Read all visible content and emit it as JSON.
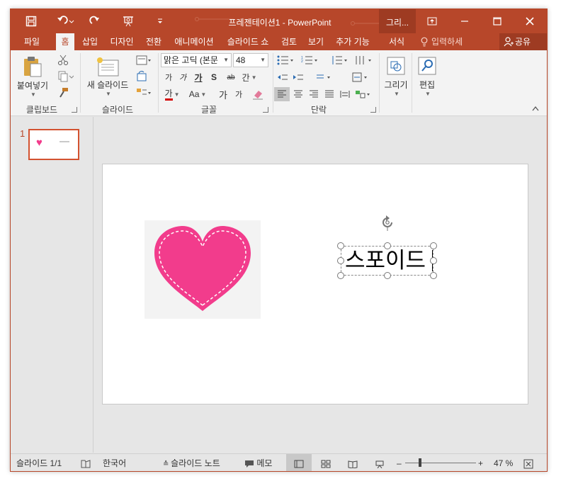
{
  "app": {
    "title": "프레젠테이션1 - PowerPoint",
    "context_tab": "그리...",
    "brand_color": "#b7472a"
  },
  "quick_access": [
    "save-icon",
    "undo-icon",
    "redo-icon",
    "slideshow-icon",
    "customize-icon"
  ],
  "tabs": [
    {
      "label": "파일"
    },
    {
      "label": "홈"
    },
    {
      "label": "삽입"
    },
    {
      "label": "디자인"
    },
    {
      "label": "전환"
    },
    {
      "label": "애니메이션"
    },
    {
      "label": "슬라이드 쇼"
    },
    {
      "label": "검토"
    },
    {
      "label": "보기"
    },
    {
      "label": "추가 기능"
    },
    {
      "label": "서식"
    }
  ],
  "active_tab": "홈",
  "tell_me": "입력하세",
  "share": "공유",
  "ribbon": {
    "clipboard": {
      "paste": "붙여넣기",
      "label": "클립보드"
    },
    "slides": {
      "new_slide": "새 슬라이드",
      "label": "슬라이드"
    },
    "font": {
      "family": "맑은 고딕 (본문",
      "size": "48",
      "label": "글꼴",
      "grow": "가",
      "shrink": "가",
      "bold": "가",
      "italic": "가",
      "underline": "가",
      "shadow": "S",
      "strike": "ab",
      "spacing": "간",
      "color": "가",
      "case": "Aa",
      "larger": "가",
      "smaller": "가"
    },
    "paragraph": {
      "label": "단락"
    },
    "drawing": {
      "label": "그리기"
    },
    "editing": {
      "label": "편집"
    }
  },
  "slides_pane": {
    "slide_number": "1"
  },
  "slide": {
    "textbox_text": "스포이드",
    "heart_color": "#f23c8c",
    "heart_bg": "#f3f3f3"
  },
  "status": {
    "slide_info": "슬라이드 1/1",
    "language": "한국어",
    "notes": "슬라이드 노트",
    "comments": "메모",
    "zoom": "47 %"
  }
}
